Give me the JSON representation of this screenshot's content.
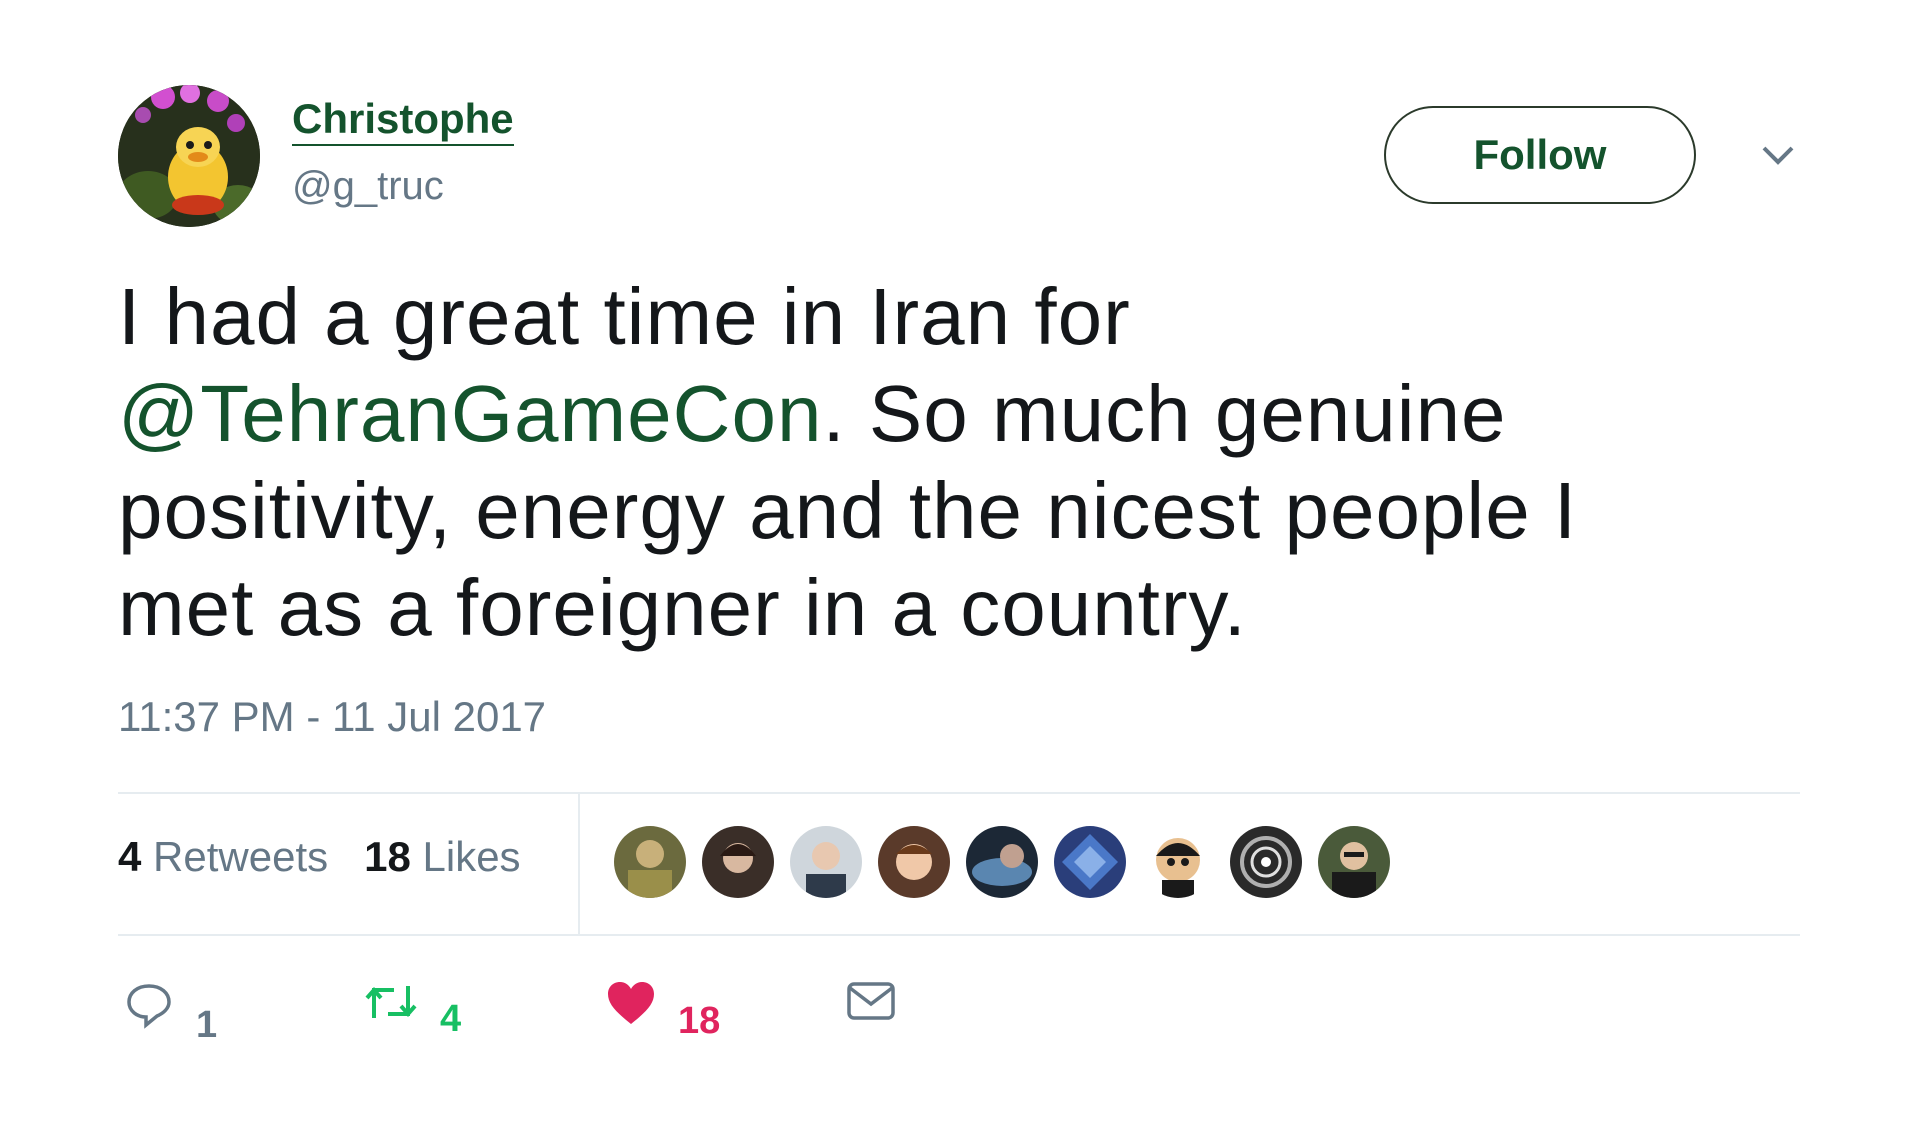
{
  "user": {
    "name": "Christophe",
    "handle": "@g_truc"
  },
  "follow_label": "Follow",
  "tweet": {
    "line1": "I had a great time in Iran for",
    "mention": "@TehranGameCon",
    "line2_rest": ". So much genuine",
    "line3": "positivity, energy and the nicest people I",
    "line4": "met as a foreigner in a country."
  },
  "timestamp": "11:37 PM - 11 Jul 2017",
  "stats": {
    "retweets_count": "4",
    "retweets_label": "Retweets",
    "likes_count": "18",
    "likes_label": "Likes"
  },
  "actions": {
    "reply_count": "1",
    "retweet_count": "4",
    "like_count": "18"
  },
  "colors": {
    "accent": "#14532d",
    "like": "#e0245e",
    "retweet": "#17bf63",
    "muted": "#657786"
  },
  "icons": [
    "reply-icon",
    "retweet-icon",
    "heart-icon",
    "direct-message-icon",
    "chevron-down-icon"
  ]
}
